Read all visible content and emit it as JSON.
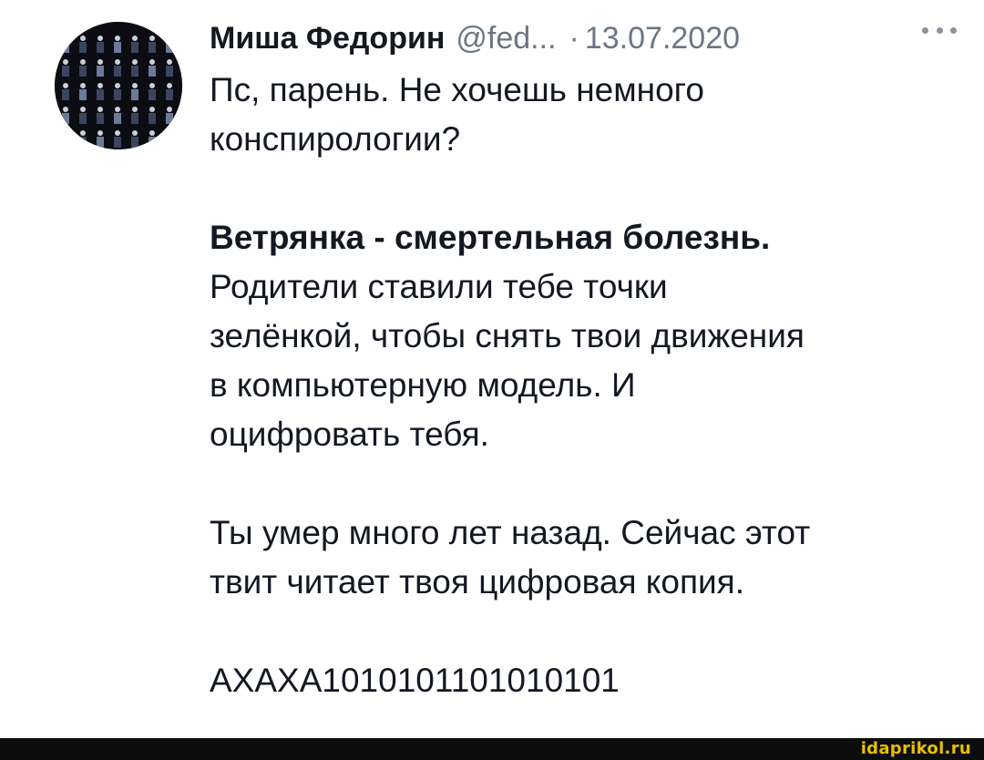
{
  "tweet": {
    "author_name": "Миша Федорин",
    "handle": "@fed...",
    "separator": "·",
    "date": "13.07.2020",
    "more_icon": "ellipsis-icon",
    "lines": {
      "l1": "Пс, парень. Не хочешь немного",
      "l2": "конспирологии?",
      "l3": "Ветрянка - смертельная болезнь.",
      "l4": "Родители ставили тебе точки",
      "l5": "зелёнкой, чтобы снять твои движения",
      "l6": "в компьютерную модель. И",
      "l7": "оцифровать тебя.",
      "l8": "Ты умер много лет назад. Сейчас этот",
      "l9": "твит читает твоя цифровая копия.",
      "l10": "АХАХА1010101101010101"
    }
  },
  "watermark": "idaprikol.ru",
  "colors": {
    "text": "#141823",
    "secondary": "#6b7684",
    "watermark": "#e8c000",
    "footer": "#0d0d0d"
  }
}
